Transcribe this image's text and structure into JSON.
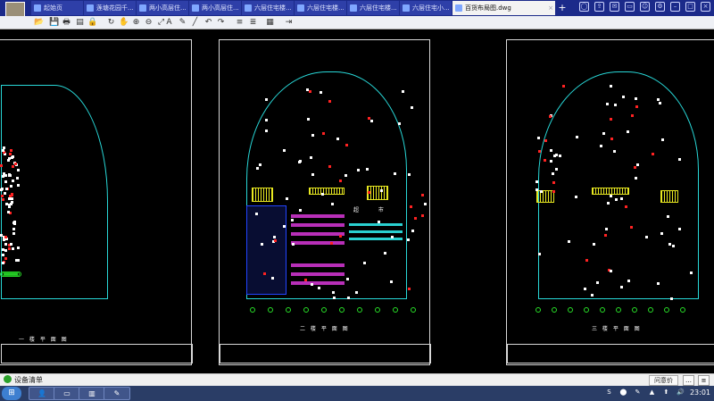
{
  "tabs": [
    {
      "label": "起始页",
      "active": false
    },
    {
      "label": "莲塘花园千...",
      "active": false
    },
    {
      "label": "两小高层住...",
      "active": false
    },
    {
      "label": "两小高层住...",
      "active": false
    },
    {
      "label": "六层住宅楼...",
      "active": false
    },
    {
      "label": "六层住宅楼...",
      "active": false
    },
    {
      "label": "六层住宅楼...",
      "active": false
    },
    {
      "label": "六层住宅小...",
      "active": false
    },
    {
      "label": "百货布局图.dwg",
      "active": true
    }
  ],
  "new_tab": "+",
  "window_icons": [
    "user-icon",
    "share-icon",
    "mail-icon",
    "screen-icon",
    "feedback-icon",
    "gear-icon",
    "minimize-icon",
    "maximize-icon",
    "close-icon"
  ],
  "window_icon_glyphs": [
    "◯",
    "⇪",
    "✉",
    "▭",
    "☺",
    "⚙",
    "–",
    "□",
    "×"
  ],
  "toolbar": {
    "items": [
      "open-icon",
      "save-icon",
      "print-icon",
      "print-preview-icon",
      "lock-icon",
      "rotate-icon",
      "pan-icon",
      "zoom-in-icon",
      "zoom-out-icon",
      "zoom-extents-icon",
      "text-icon",
      "pen-icon",
      "line-icon",
      "undo-icon",
      "redo-icon",
      "layer-icon",
      "layer-off-icon",
      "measure-icon",
      "export-icon"
    ],
    "glyphs": [
      "📂",
      "💾",
      "🖶",
      "▤",
      "🔒",
      "↻",
      "✋",
      "⊕",
      "⊖",
      "⤢",
      "A",
      "✎",
      "╱",
      "↶",
      "↷",
      "≡",
      "≣",
      "▦",
      "⇥"
    ]
  },
  "drawing": {
    "sheets": [
      {
        "floor_label": "一 楼 平 面 图"
      },
      {
        "floor_label": "二 楼 平 面 图",
        "store_label": "超 市"
      },
      {
        "floor_label": "三 楼 平 面 图"
      }
    ]
  },
  "statusbar": {
    "text": "设备清单",
    "feedback": "问意价",
    "icon1": "…",
    "icon2": "≡"
  },
  "taskbar": {
    "start": "⊞",
    "apps": [
      "explorer-icon",
      "monitor-icon",
      "books-icon",
      "cad-icon"
    ],
    "app_glyphs": [
      "👤",
      "▭",
      "▥",
      "✎"
    ],
    "tray": [
      "S",
      "⬤",
      "✎",
      "▲",
      "⬆",
      "🔊"
    ],
    "clock": "23:01"
  },
  "colors": {
    "tabbar": "#1b2a8a",
    "bg": "#000000",
    "cyan": "#28d8d8",
    "green": "#28e028",
    "red": "#ff2222",
    "magenta": "#b82fb8",
    "yellow": "#e8e820",
    "blue": "#2244ff"
  }
}
